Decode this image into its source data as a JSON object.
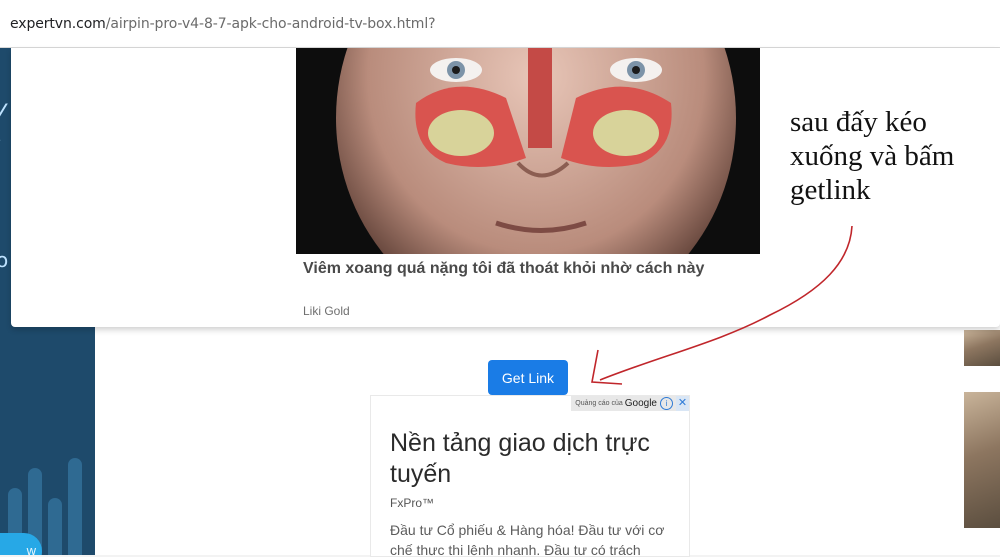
{
  "browser": {
    "url_host": "expertvn.com",
    "url_path": "/airpin-pro-v4-8-7-apk-cho-android-tv-box.html?"
  },
  "popup_ad": {
    "image_icon": "face-sinus-anatomy-icon",
    "title": "Viêm xoang quá nặng tôi đã thoát khỏi nhờ cách này",
    "source": "Liki Gold"
  },
  "main": {
    "get_link_label": "Get Link"
  },
  "google_ad": {
    "badge_text": "Quảng cáo của",
    "badge_brand": "Google",
    "badge_info": "i",
    "badge_close": "✕",
    "headline": "Nền tảng giao dịch trực tuyến",
    "advertiser": "FxPro™",
    "description": "Đầu tư Cổ phiếu & Hàng hóa! Đầu tư với cơ chế thực thi lệnh nhanh. Đầu tư có trách"
  },
  "annotation": {
    "text": "sau đấy kéo xuống và bấm getlink",
    "color": "#c0262b"
  },
  "left_panel": {
    "button_text": "w",
    "accent_color": "#27a8e6"
  },
  "colors": {
    "primary_button": "#1a7ce6",
    "sidebar_bg": "#1e4a6b"
  }
}
